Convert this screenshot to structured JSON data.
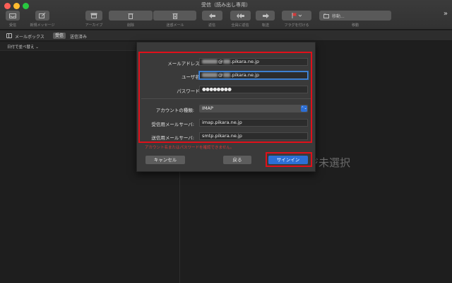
{
  "window": {
    "title": "受信（読み出し専用）"
  },
  "toolbar": {
    "receive": "受信",
    "new_message": "新規メッセージ",
    "archive": "アーカイブ",
    "delete": "削除",
    "junk": "迷惑メール",
    "reply": "返信",
    "reply_all": "全員に返信",
    "forward": "転送",
    "flag": "フラグを付ける",
    "move": "移動",
    "move_field": "移動..."
  },
  "mailbox_bar": {
    "label": "メールボックス",
    "inbox": "受信",
    "sent": "送信済み"
  },
  "sort": {
    "label": "日付で並べ替え ⌄"
  },
  "viewer": {
    "no_selection": "ジ未選択"
  },
  "dialog": {
    "email_label": "メールアドレス:",
    "email_value": "@",
    "email_domain": ".pikara.ne.jp",
    "username_label": "ユーザ名:",
    "username_value": "@",
    "username_domain": ".pikara.ne.jp",
    "password_label": "パスワード:",
    "password_value": "●●●●●●●●",
    "account_type_label": "アカウントの種類:",
    "account_type_value": "IMAP",
    "incoming_label": "受信用メールサーバ:",
    "incoming_value": "imap.pikara.ne.jp",
    "outgoing_label": "送信用メールサーバ:",
    "outgoing_value": "smtp.pikara.ne.jp",
    "error_text": "アカウント名またはパスワードを確認できません。",
    "cancel": "キャンセル",
    "back": "戻る",
    "sign_in": "サインイン"
  },
  "colors": {
    "highlight": "#e0101a",
    "accent": "#2c6fd6",
    "error": "#d23b3b"
  }
}
